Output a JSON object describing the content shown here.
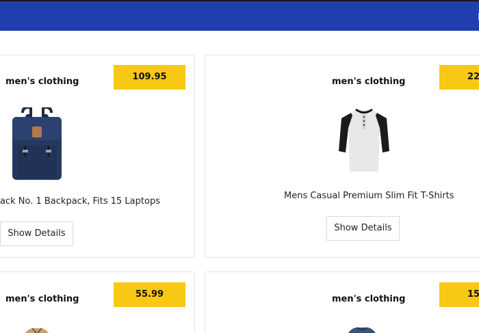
{
  "header": {
    "nav_text": "P"
  },
  "products": [
    {
      "category": "men's clothing",
      "price": "109.95",
      "title": "ack No. 1 Backpack, Fits 15 Laptops",
      "button": "Show Details",
      "image": "backpack"
    },
    {
      "category": "men's clothing",
      "price": "22.",
      "title": "Mens Casual Premium Slim Fit T-Shirts",
      "button": "Show Details",
      "image": "raglan-tshirt"
    },
    {
      "category": "men's clothing",
      "price": "55.99",
      "title": "",
      "button": "",
      "image": "jacket"
    },
    {
      "category": "men's clothing",
      "price": "15.",
      "title": "",
      "button": "",
      "image": "tshirt"
    }
  ]
}
